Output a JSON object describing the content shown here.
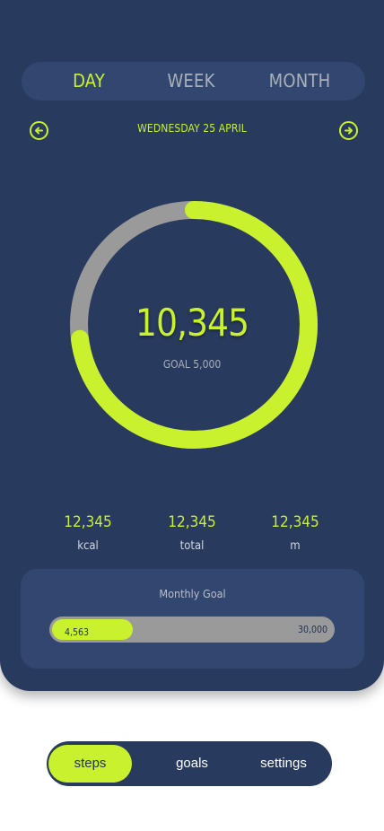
{
  "period_tabs": [
    "DAY",
    "WEEK",
    "MONTH"
  ],
  "active_tab": "DAY",
  "date": "WEDNESDAY 25 APRIL",
  "steps": {
    "value": "10,345",
    "goal_label": "GOAL 5,000"
  },
  "ring_progress": 0.73,
  "stats": [
    {
      "value": "12,345",
      "label": "kcal"
    },
    {
      "value": "12,345",
      "label": "total"
    },
    {
      "value": "12,345",
      "label": "m"
    }
  ],
  "monthly": {
    "title": "Monthly Goal",
    "current": "4,563",
    "target": "30,000",
    "progress": 0.29
  },
  "bottom_nav": [
    "steps",
    "goals",
    "settings"
  ],
  "active_nav": "steps",
  "icons": {
    "prev": "arrow-left-circle-icon",
    "next": "arrow-right-circle-icon"
  },
  "colors": {
    "background": "#283a5e",
    "panel": "#32476f",
    "accent": "#c9f12d",
    "track": "#9a9a9a"
  }
}
